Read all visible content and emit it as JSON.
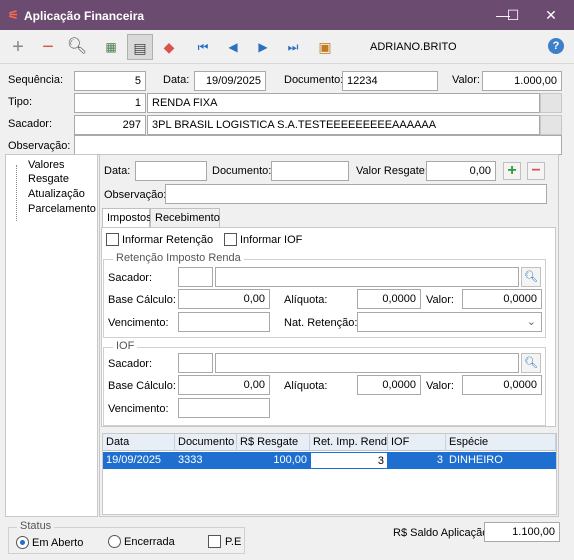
{
  "window": {
    "title": "Aplicação Financeira",
    "minimize": "—",
    "maximize": "☐",
    "close": "✕"
  },
  "toolbar": {
    "user": "ADRIANO.BRITO",
    "help": "?"
  },
  "header": {
    "sequencia_label": "Sequência:",
    "sequencia": "5",
    "data_label": "Data:",
    "data": "19/09/2025",
    "documento_label": "Documento:",
    "documento": "12234",
    "valor_label": "Valor:",
    "valor": "1.000,00",
    "tipo_label": "Tipo:",
    "tipo_code": "1",
    "tipo_name": "RENDA FIXA",
    "sacador_label": "Sacador:",
    "sacador_code": "297",
    "sacador_name": "3PL BRASIL LOGISTICA S.A.TESTEEEEEEEEEAAAAAA",
    "observacao_label": "Observação:",
    "observacao": ""
  },
  "tree": {
    "items": [
      "Valores",
      "Resgate",
      "Atualização",
      "Parcelamento"
    ]
  },
  "resgate": {
    "data_label": "Data:",
    "data": "",
    "documento_label": "Documento:",
    "documento": "",
    "valor_label": "Valor Resgate:",
    "valor": "0,00",
    "observacao_label": "Observação:",
    "observacao": ""
  },
  "tabs": [
    "Impostos",
    "Recebimento"
  ],
  "impostos": {
    "informar_retencao": "Informar Retenção",
    "informar_iof": "Informar IOF",
    "ir": {
      "title": "Retenção Imposto Renda",
      "sacador_label": "Sacador:",
      "base_label": "Base Cálculo:",
      "base": "0,00",
      "aliquota_label": "Alíquota:",
      "aliquota": "0,0000",
      "valor_label": "Valor:",
      "valor": "0,0000",
      "vencimento_label": "Vencimento:",
      "nat_label": "Nat. Retenção:"
    },
    "iof": {
      "title": "IOF",
      "sacador_label": "Sacador:",
      "base_label": "Base Cálculo:",
      "base": "0,00",
      "aliquota_label": "Alíquota:",
      "aliquota": "0,0000",
      "valor_label": "Valor:",
      "valor": "0,0000",
      "vencimento_label": "Vencimento:"
    }
  },
  "grid": {
    "columns": [
      "Data",
      "Documento",
      "R$ Resgate",
      "Ret. Imp. Renda",
      "IOF",
      "Espécie"
    ],
    "rows": [
      [
        "19/09/2025",
        "3333",
        "100,00",
        "3",
        "3",
        "DINHEIRO"
      ]
    ]
  },
  "footer": {
    "status_title": "Status",
    "em_aberto": "Em Aberto",
    "encerrada": "Encerrada",
    "pe": "P.E",
    "saldo_label": "R$ Saldo Aplicação:",
    "saldo": "1.100,00"
  }
}
